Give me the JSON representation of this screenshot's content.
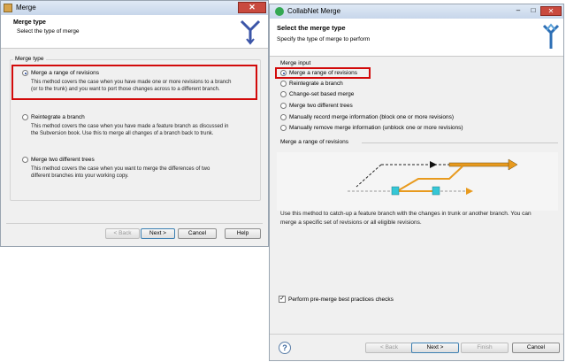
{
  "left": {
    "window_title": "Merge",
    "close_glyph": "✕",
    "header_title": "Merge type",
    "header_subtitle": "Select the type of merge",
    "group_label": "Merge type",
    "options": [
      {
        "label": "Merge a range of revisions",
        "selected": true,
        "desc1": "This method covers the case when you have made one or more revisions to a branch",
        "desc2": "(or to the trunk) and you want to port those changes across to a different branch."
      },
      {
        "label": "Reintegrate a branch",
        "selected": false,
        "desc1": "This method covers the case when you have made a feature branch as discussed in",
        "desc2": "the Subversion book. Use this to merge all changes of a branch back to trunk."
      },
      {
        "label": "Merge two different trees",
        "selected": false,
        "desc1": "This method covers the case when you want to merge the differences of two",
        "desc2": "different branches into your working copy."
      }
    ],
    "buttons": {
      "back": "< Back",
      "next": "Next >",
      "cancel": "Cancel",
      "help": "Help"
    }
  },
  "right": {
    "window_title": "CollabNet Merge",
    "window_controls": {
      "minimize": "–",
      "maximize": "□",
      "close": "✕"
    },
    "header_title": "Select the merge type",
    "header_subtitle": "Specify the type of merge to perform",
    "group_label": "Merge input",
    "options": [
      {
        "label": "Merge a range of revisions",
        "selected": true
      },
      {
        "label": "Reintegrate a branch",
        "selected": false
      },
      {
        "label": "Change-set based merge",
        "selected": false
      },
      {
        "label": "Merge two different trees",
        "selected": false
      },
      {
        "label": "Manually record merge information (block one or more revisions)",
        "selected": false
      },
      {
        "label": "Manually remove merge information (unblock one or more revisions)",
        "selected": false
      }
    ],
    "section_label": "Merge a range of revisions",
    "description1": "Use this method to catch-up a feature branch with the changes in trunk or another branch.  You can",
    "description2": "merge a specific set of revisions or all eligible revisions.",
    "checkbox_label": "Perform pre-merge best practices checks",
    "checkbox_checked": true,
    "help_glyph": "?",
    "buttons": {
      "back": "< Back",
      "next": "Next >",
      "finish": "Finish",
      "cancel": "Cancel"
    }
  },
  "colors": {
    "highlight_box": "#d20a0a",
    "arrow_orange": "#e89a1e",
    "marker_cyan": "#35c7d6"
  }
}
